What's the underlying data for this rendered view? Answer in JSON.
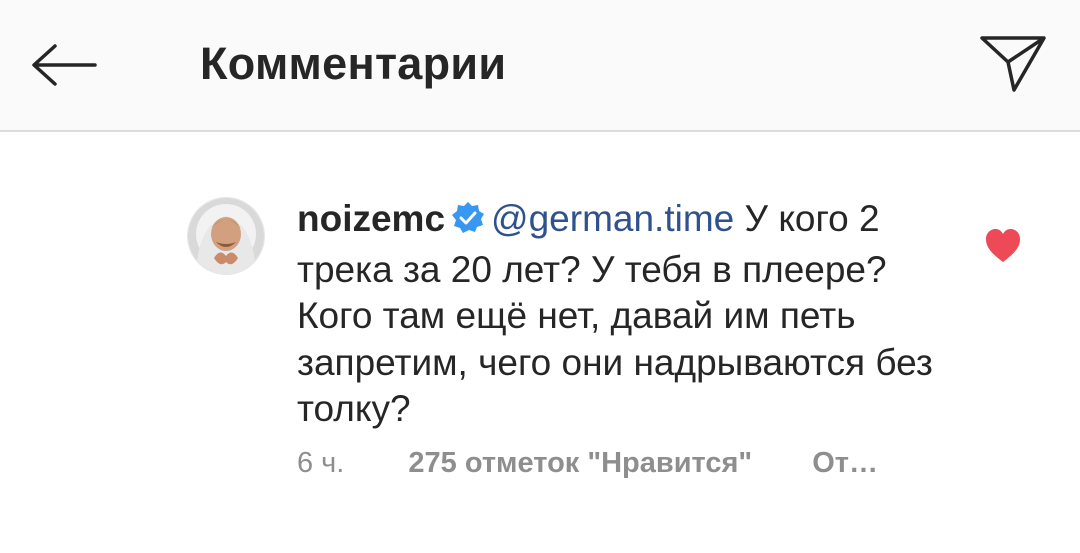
{
  "header": {
    "title": "Комментарии",
    "back_icon": "arrow-left-icon",
    "share_icon": "paper-plane-icon"
  },
  "comment": {
    "avatar_icon": "avatar",
    "username": "noizemc",
    "verified_icon": "verified-badge-icon",
    "mention": "@german.time",
    "text": " У кого 2 трека за 20 лет? У тебя в плеере? Кого там ещё нет, давай им петь запретим, чего они надрываются без толку?",
    "time": "6 ч.",
    "likes": "275 отметок \"Нравится\"",
    "reply": "От…",
    "liked": true,
    "like_icon": "heart-icon"
  },
  "colors": {
    "header_bg": "#fafafa",
    "divider": "#dbdbdb",
    "text": "#262626",
    "secondary": "#8e8e8e",
    "mention": "#30528c",
    "verified": "#3897f0",
    "heart": "#ed4956"
  }
}
